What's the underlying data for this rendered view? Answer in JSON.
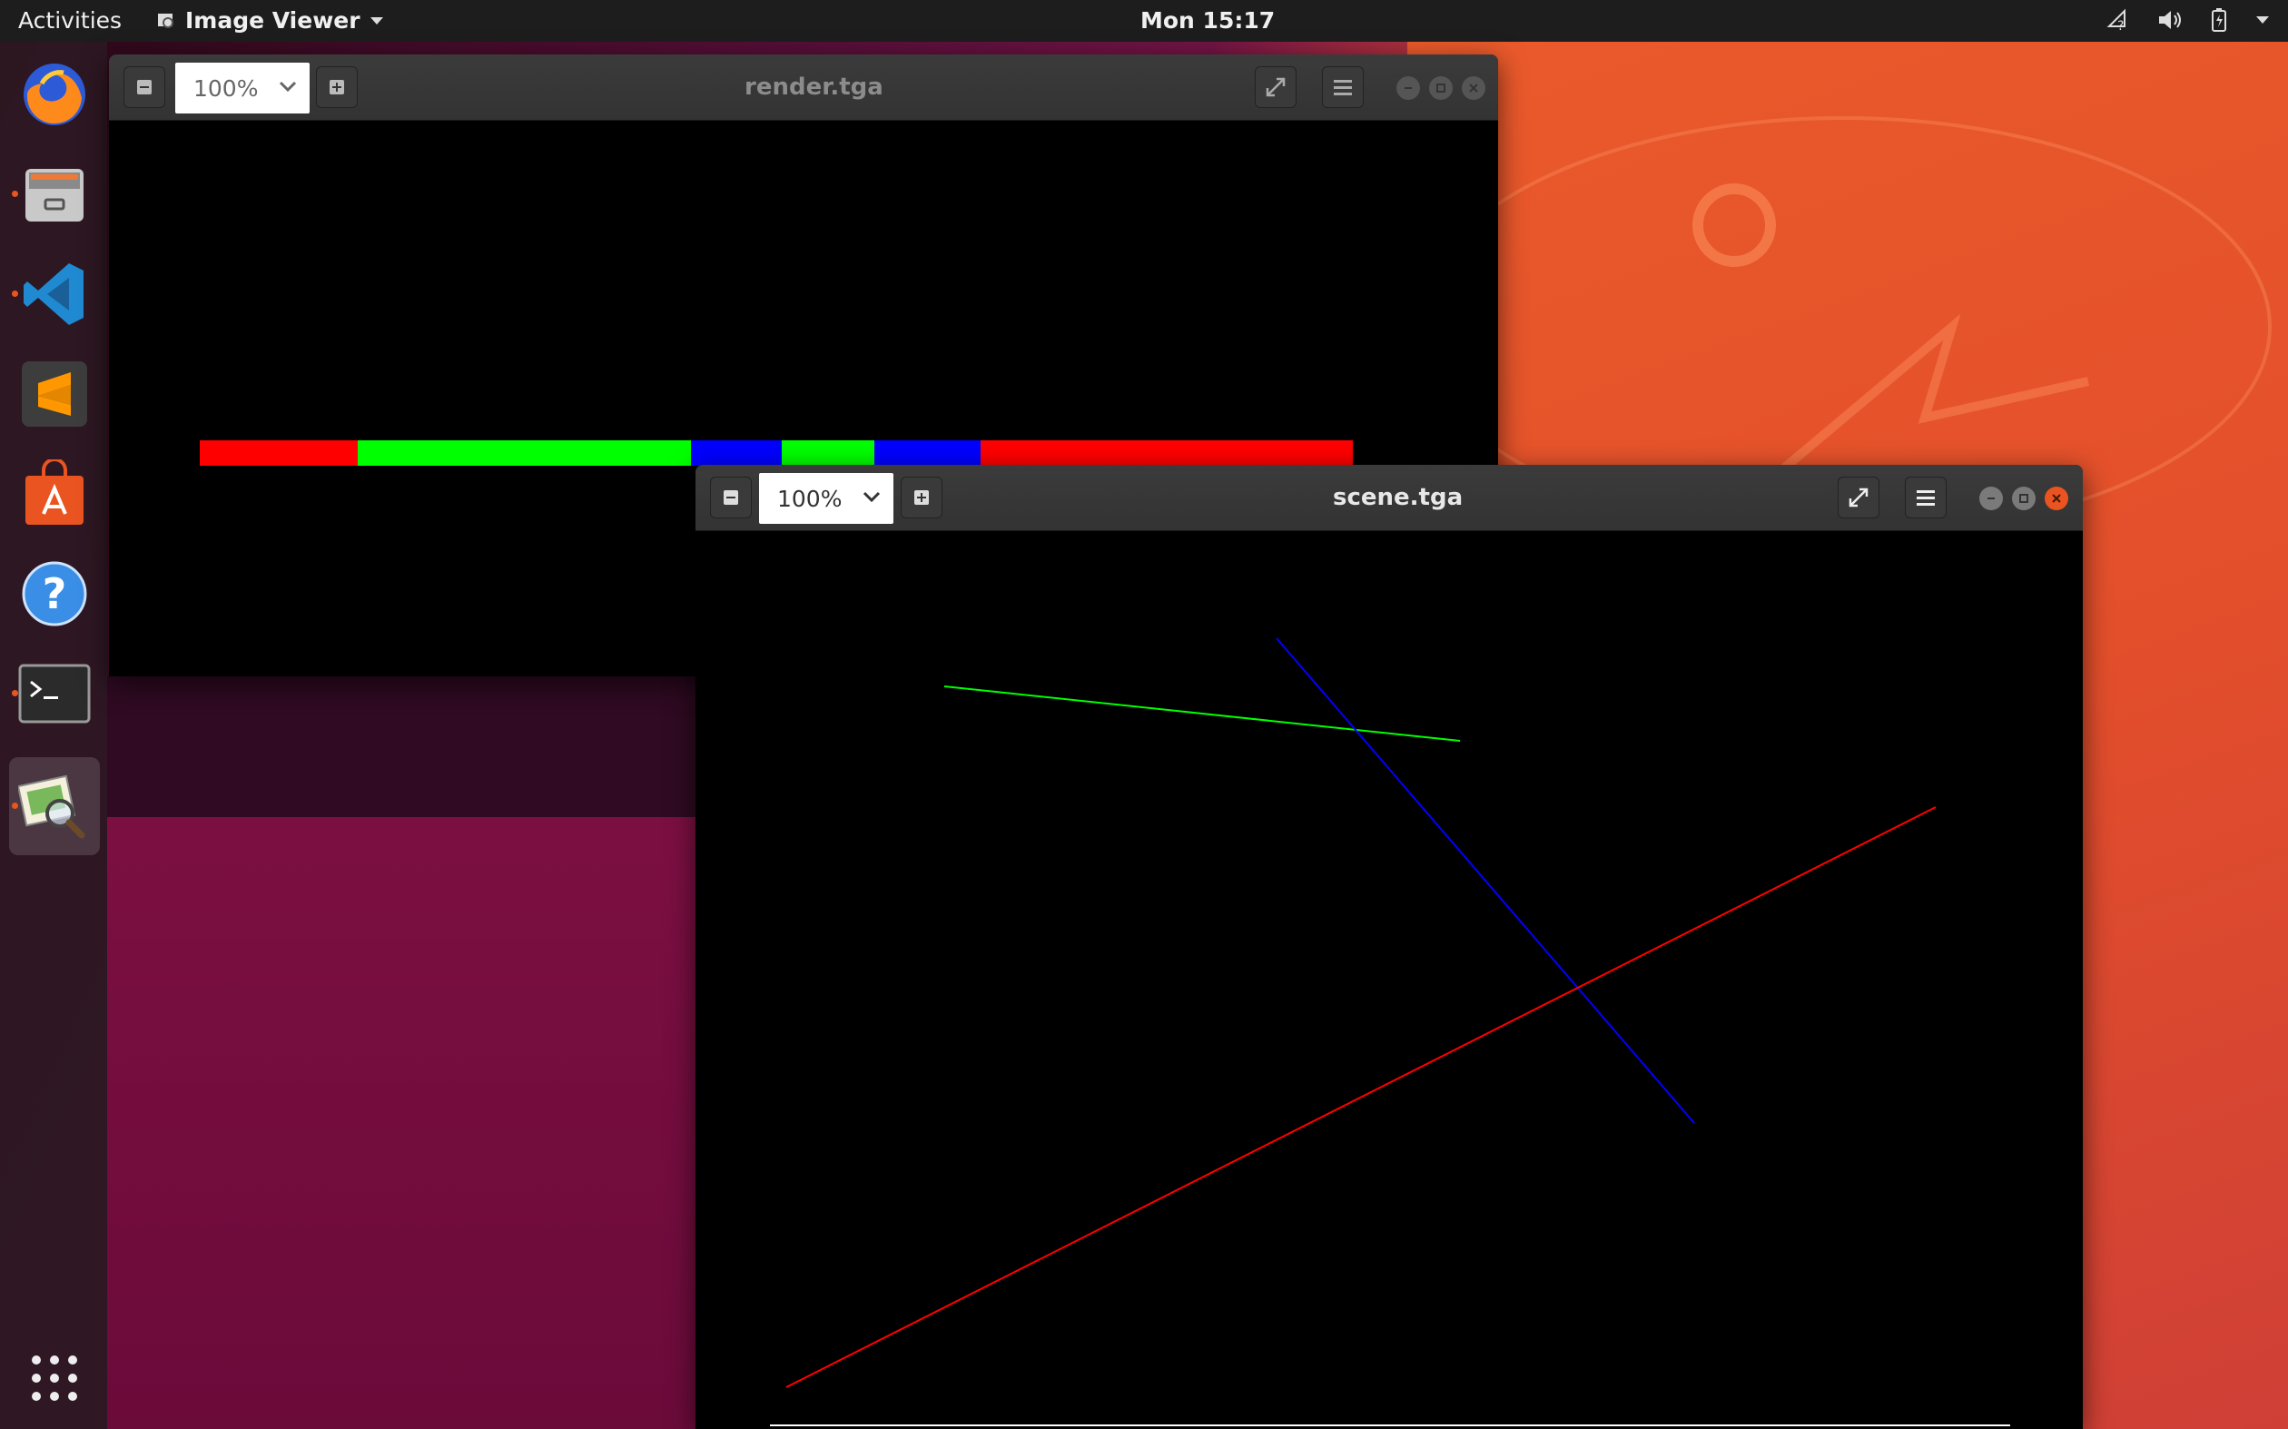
{
  "topbar": {
    "activities": "Activities",
    "app_name": "Image Viewer",
    "clock": "Mon 15:17"
  },
  "dock": {
    "items": [
      {
        "name": "firefox-icon"
      },
      {
        "name": "files-icon"
      },
      {
        "name": "vscode-icon"
      },
      {
        "name": "sublime-icon"
      },
      {
        "name": "software-center-icon"
      },
      {
        "name": "help-icon"
      },
      {
        "name": "terminal-icon"
      },
      {
        "name": "image-viewer-icon"
      },
      {
        "name": "show-apps-icon"
      }
    ]
  },
  "window_render": {
    "title": "render.tga",
    "zoom": "100%",
    "strip_colors": [
      "#ff0000",
      "#00ff00",
      "#0000ff",
      "#00ff00",
      "#0000ff",
      "#ff0000"
    ]
  },
  "window_scene": {
    "title": "scene.tga",
    "zoom": "100%",
    "line_colors": {
      "green": "#00ff00",
      "blue": "#0000ff",
      "red": "#ff0000",
      "white": "#ffffff"
    }
  }
}
